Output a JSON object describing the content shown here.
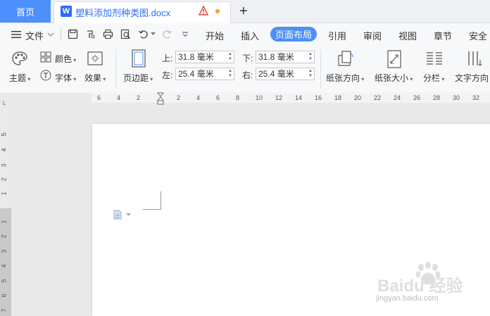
{
  "tabs": {
    "home": "首页",
    "doc_title": "塑料添加剂种类图.docx",
    "doc_icon_letter": "W",
    "new_tab": "+"
  },
  "menu": {
    "file": "文件",
    "items": [
      "开始",
      "插入",
      "页面布局",
      "引用",
      "审阅",
      "视图",
      "章节",
      "安全"
    ],
    "active": "页面布局"
  },
  "ribbon": {
    "theme": "主题",
    "color": "颜色",
    "font": "字体",
    "effect": "效果",
    "margin": "页边距",
    "top_label": "上:",
    "top_value": "31.8 毫米",
    "bottom_label": "下:",
    "bottom_value": "31.8 毫米",
    "left_label": "左:",
    "left_value": "25.4 毫米",
    "right_label": "右:",
    "right_value": "25.4 毫米",
    "orientation": "纸张方向",
    "size": "纸张大小",
    "columns": "分栏",
    "text_direction": "文字方向"
  },
  "ruler": {
    "h_ticks": [
      "6",
      "4",
      "2",
      "2",
      "4",
      "6",
      "8",
      "10",
      "12",
      "14",
      "16",
      "18",
      "20",
      "22",
      "24",
      "26",
      "28",
      "30",
      "32"
    ],
    "v_ticks_upper": [
      "5",
      "4",
      "3",
      "2",
      "1"
    ],
    "v_ticks_lower": [
      "1",
      "2",
      "3",
      "4",
      "5",
      "6",
      "7"
    ],
    "corner": "L"
  },
  "watermark": {
    "brand": "Baidu 经验",
    "url": "jingyan.baidu.com"
  },
  "colors": {
    "accent": "#4d8ffb",
    "doc_blue": "#2b6cf6",
    "warning": "#e04a3a",
    "unsaved_dot": "#f59a3d"
  }
}
